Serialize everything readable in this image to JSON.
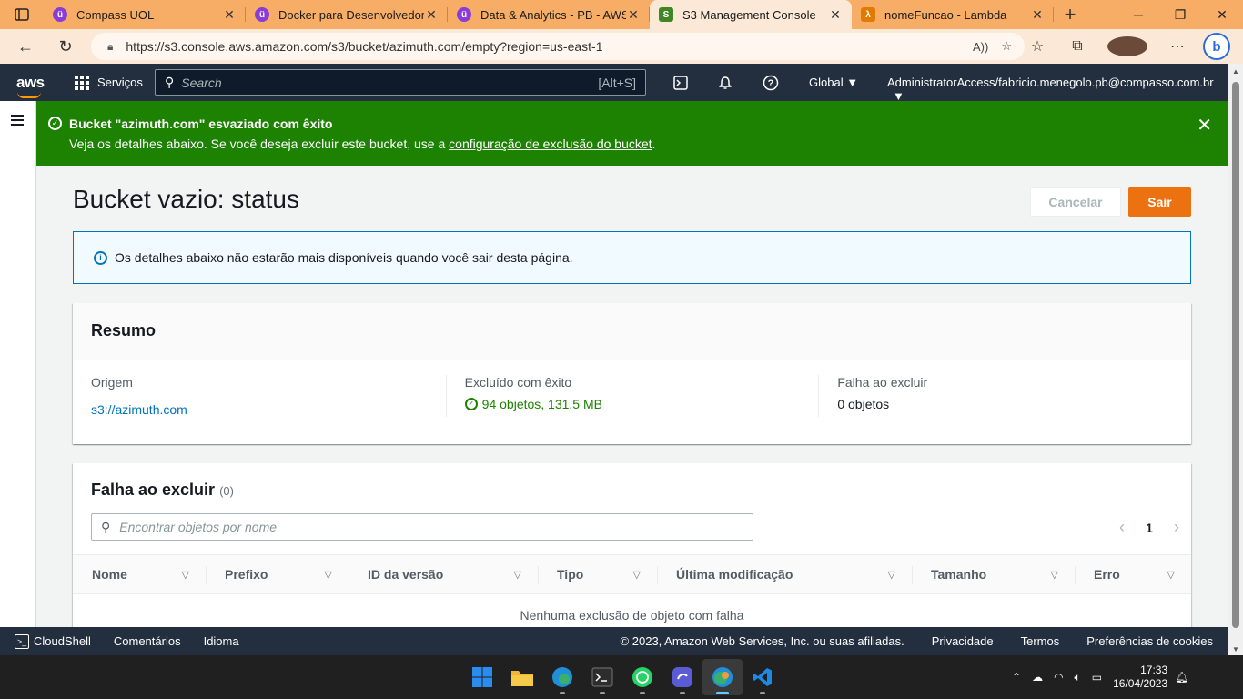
{
  "browser": {
    "tabs": [
      {
        "title": "Compass UOL",
        "favicon_color": "#8a3bd8",
        "favicon_glyph": "ü"
      },
      {
        "title": "Docker para Desenvolvedores",
        "favicon_color": "#8a3bd8",
        "favicon_glyph": "ü"
      },
      {
        "title": "Data & Analytics - PB - AWS (",
        "favicon_color": "#8a3bd8",
        "favicon_glyph": "ü"
      },
      {
        "title": "S3 Management Console",
        "favicon_color": "#3f8624",
        "favicon_glyph": "S",
        "active": true
      },
      {
        "title": "nomeFuncao - Lambda",
        "favicon_color": "#e07b00",
        "favicon_glyph": "λ"
      }
    ],
    "url": "https://s3.console.aws.amazon.com/s3/bucket/azimuth.com/empty?region=us-east-1",
    "tab_strip_color": "#f7ad66",
    "toolbar_color": "#fbe8d6"
  },
  "aws_header": {
    "logo": "aws",
    "services_label": "Serviços",
    "search_placeholder": "Search",
    "search_shortcut": "[Alt+S]",
    "region_label": "Global",
    "account_label": "AdministratorAccess/fabricio.menegolo.pb@compasso.com.br"
  },
  "flash": {
    "title": "Bucket \"azimuth.com\" esvaziado com êxito",
    "description_prefix": "Veja os detalhes abaixo. Se você deseja excluir este bucket, use a",
    "description_link": "configuração de exclusão do bucket",
    "description_suffix": ".",
    "color": "#1d8102"
  },
  "page": {
    "title": "Bucket vazio: status",
    "cancel_label": "Cancelar",
    "exit_label": "Sair",
    "info_message": "Os detalhes abaixo não estarão mais disponíveis quando você sair desta página."
  },
  "summary": {
    "heading": "Resumo",
    "source_label": "Origem",
    "source_value": "s3://azimuth.com",
    "success_label": "Excluído com êxito",
    "success_value": "94 objetos, 131.5 MB",
    "failed_label": "Falha ao excluir",
    "failed_value": "0 objetos"
  },
  "failures": {
    "heading": "Falha ao excluir",
    "count": "(0)",
    "search_placeholder": "Encontrar objetos por nome",
    "page_number": "1",
    "columns": [
      "Nome",
      "Prefixo",
      "ID da versão",
      "Tipo",
      "Última modificação",
      "Tamanho",
      "Erro"
    ],
    "empty_message": "Nenhuma exclusão de objeto com falha"
  },
  "footer": {
    "cloudshell": "CloudShell",
    "feedback": "Comentários",
    "language": "Idioma",
    "copyright": "© 2023, Amazon Web Services, Inc. ou suas afiliadas.",
    "privacy": "Privacidade",
    "terms": "Termos",
    "cookies": "Preferências de cookies"
  },
  "taskbar": {
    "apps": [
      {
        "name": "windows-start",
        "color": "#2b8cf0"
      },
      {
        "name": "file-explorer",
        "color": "#f2b731"
      },
      {
        "name": "edge-browser",
        "color": "#1f8fd8"
      },
      {
        "name": "terminal",
        "color": "#2d2d2d"
      },
      {
        "name": "whatsapp",
        "color": "#25d366"
      },
      {
        "name": "app-purple",
        "color": "#5b5bd6"
      },
      {
        "name": "edge-browser-active",
        "color": "#3bb06d"
      },
      {
        "name": "vscode",
        "color": "#1e88e5"
      }
    ],
    "time": "17:33",
    "date": "16/04/2023"
  }
}
